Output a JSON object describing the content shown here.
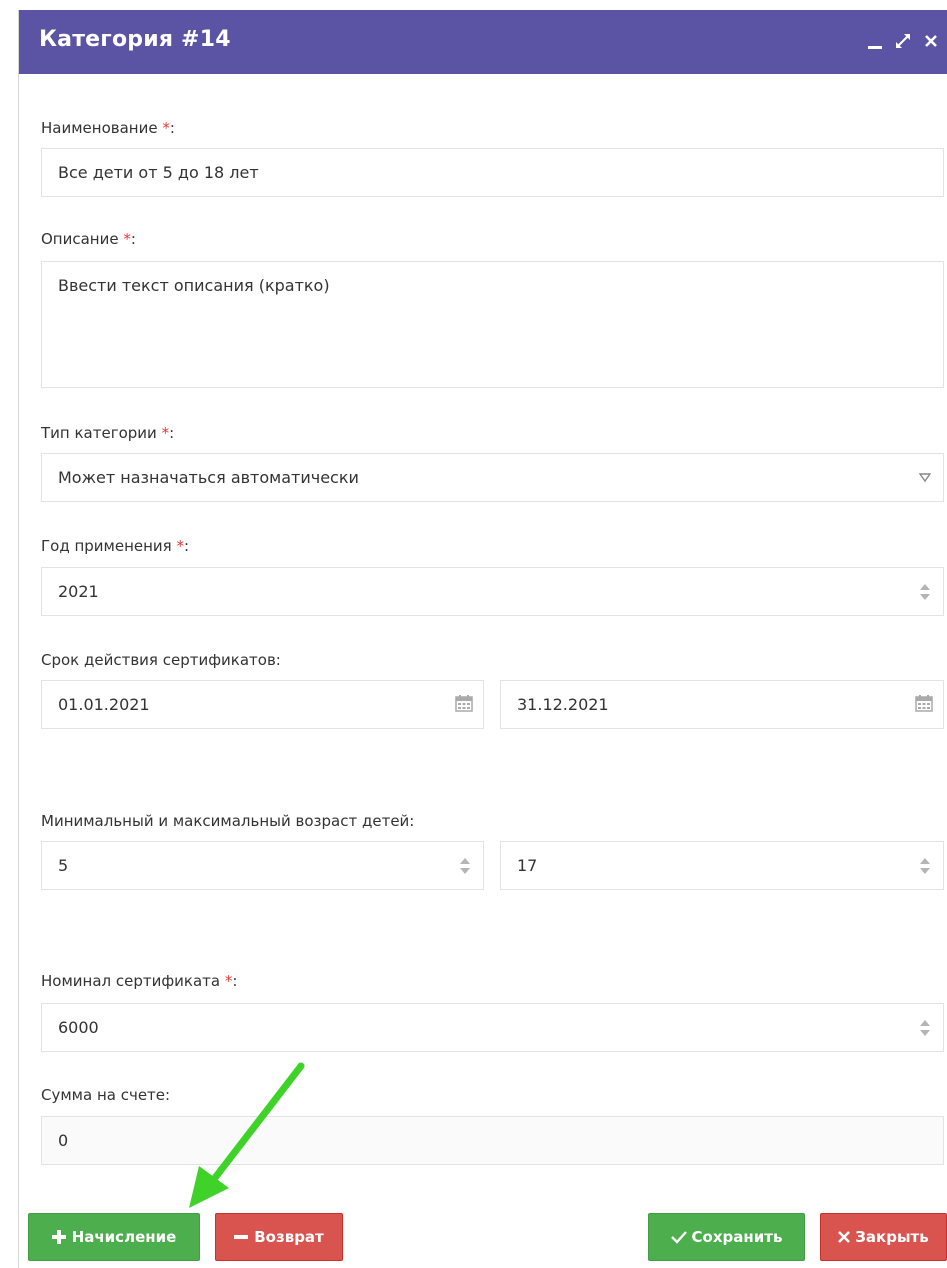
{
  "window": {
    "title": "Категория #14"
  },
  "form": {
    "required_mark": "*",
    "name": {
      "label": "Наименование",
      "suffix": ":",
      "value": "Все дети от 5 до 18 лет"
    },
    "description": {
      "label": "Описание",
      "suffix": ":",
      "value": "Ввести текст описания (кратко)"
    },
    "category_type": {
      "label": "Тип категории",
      "suffix": ":",
      "value": "Может назначаться автоматически"
    },
    "year": {
      "label": "Год применения",
      "suffix": ":",
      "value": "2021"
    },
    "validity": {
      "label": "Срок действия сертификатов:",
      "from": "01.01.2021",
      "to": "31.12.2021"
    },
    "age": {
      "label": "Минимальный и максимальный возраст детей:",
      "min": "5",
      "max": "17"
    },
    "nominal": {
      "label": "Номинал сертификата",
      "suffix": ":",
      "value": "6000"
    },
    "balance": {
      "label": "Сумма на счете:",
      "value": "0"
    }
  },
  "buttons": {
    "accrual": {
      "icon": "plus-icon",
      "label": "Начисление"
    },
    "refund": {
      "icon": "minus-icon",
      "label": "Возврат"
    },
    "save": {
      "icon": "check-icon",
      "label": "Сохранить"
    },
    "close": {
      "icon": "x-icon",
      "label": "Закрыть"
    }
  },
  "colors": {
    "titlebar": "#5b53a4",
    "green": "#4cae4c",
    "red": "#d9534f",
    "required": "#e53935",
    "annotation_arrow": "#3fd32a"
  }
}
